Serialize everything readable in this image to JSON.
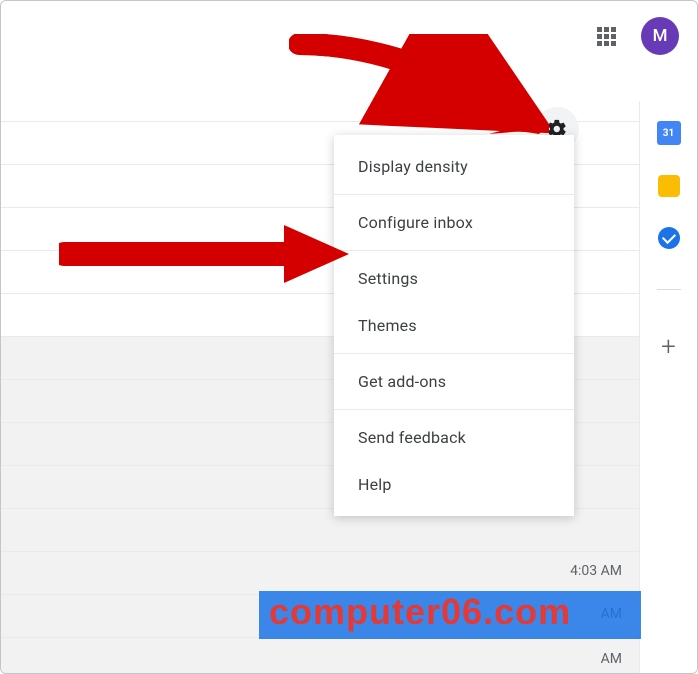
{
  "header": {
    "avatar_letter": "M"
  },
  "settings_menu": {
    "items": [
      "Display density",
      "Configure inbox",
      "Settings",
      "Themes",
      "Get add-ons",
      "Send feedback",
      "Help"
    ]
  },
  "side_panel": {
    "calendar_day": "31"
  },
  "timestamps": {
    "t1": "4:03 AM",
    "t2": "AM",
    "t3": "AM"
  },
  "watermark": "computer06.com"
}
